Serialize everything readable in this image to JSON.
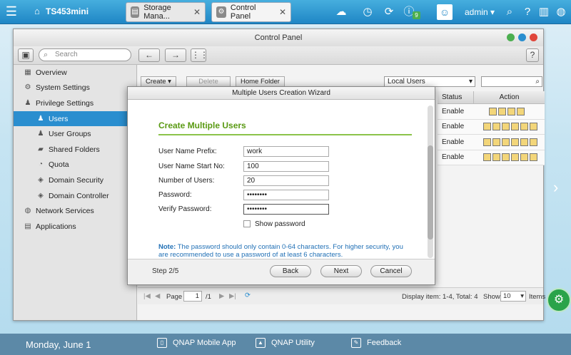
{
  "topbar": {
    "host": "TS453mini",
    "tabs": [
      {
        "label": "Storage Mana..."
      },
      {
        "label": "Control Panel"
      }
    ],
    "notification_count": "9",
    "user": "admin"
  },
  "window": {
    "title": "Control Panel",
    "search_placeholder": "Search"
  },
  "sidebar": {
    "items": [
      {
        "label": "Overview",
        "icon": "grid-icon"
      },
      {
        "label": "System Settings",
        "icon": "gear-icon"
      },
      {
        "label": "Privilege Settings",
        "icon": "user-icon"
      },
      {
        "label": "Users",
        "icon": "user-icon"
      },
      {
        "label": "User Groups",
        "icon": "group-icon"
      },
      {
        "label": "Shared Folders",
        "icon": "folder-icon"
      },
      {
        "label": "Quota",
        "icon": "quota-icon"
      },
      {
        "label": "Domain Security",
        "icon": "domain-icon"
      },
      {
        "label": "Domain Controller",
        "icon": "controller-icon"
      },
      {
        "label": "Network Services",
        "icon": "globe-icon"
      },
      {
        "label": "Applications",
        "icon": "apps-icon"
      }
    ]
  },
  "main": {
    "buttons": {
      "create": "Create",
      "delete": "Delete",
      "home_folder": "Home Folder"
    },
    "filter": "Local Users",
    "grid_headers": {
      "status": "Status",
      "action": "Action"
    },
    "rows": [
      {
        "status": "Enable"
      },
      {
        "status": "Enable"
      },
      {
        "status": "Enable"
      },
      {
        "status": "Enable"
      }
    ],
    "pager": {
      "page_label": "Page",
      "page": "1",
      "total_pages": "/1",
      "display": "Display item: 1-4, Total: 4",
      "show_label": "Show",
      "show_value": "10",
      "items_label": "Items"
    }
  },
  "wizard": {
    "title": "Multiple Users Creation Wizard",
    "heading": "Create Multiple Users",
    "fields": {
      "prefix_label": "User Name Prefix:",
      "prefix_value": "work",
      "start_label": "User Name Start No:",
      "start_value": "100",
      "count_label": "Number of Users:",
      "count_value": "20",
      "password_label": "Password:",
      "password_value": "••••••••",
      "verify_label": "Verify Password:",
      "verify_value": "••••••••",
      "show_password": "Show password"
    },
    "note_bold": "Note:",
    "note": " The password should only contain 0-64 characters. For higher security, you are recommended to use a password of at least 6 characters.",
    "step": "Step 2/5",
    "back": "Back",
    "next": "Next",
    "cancel": "Cancel"
  },
  "bottom": {
    "date": "Monday, June 1",
    "apps": [
      "QNAP Mobile App",
      "QNAP Utility",
      "Feedback"
    ]
  },
  "colors": {
    "accent": "#2a8ecf",
    "heading_green": "#5a9a13",
    "note_blue": "#1f6fb5"
  }
}
